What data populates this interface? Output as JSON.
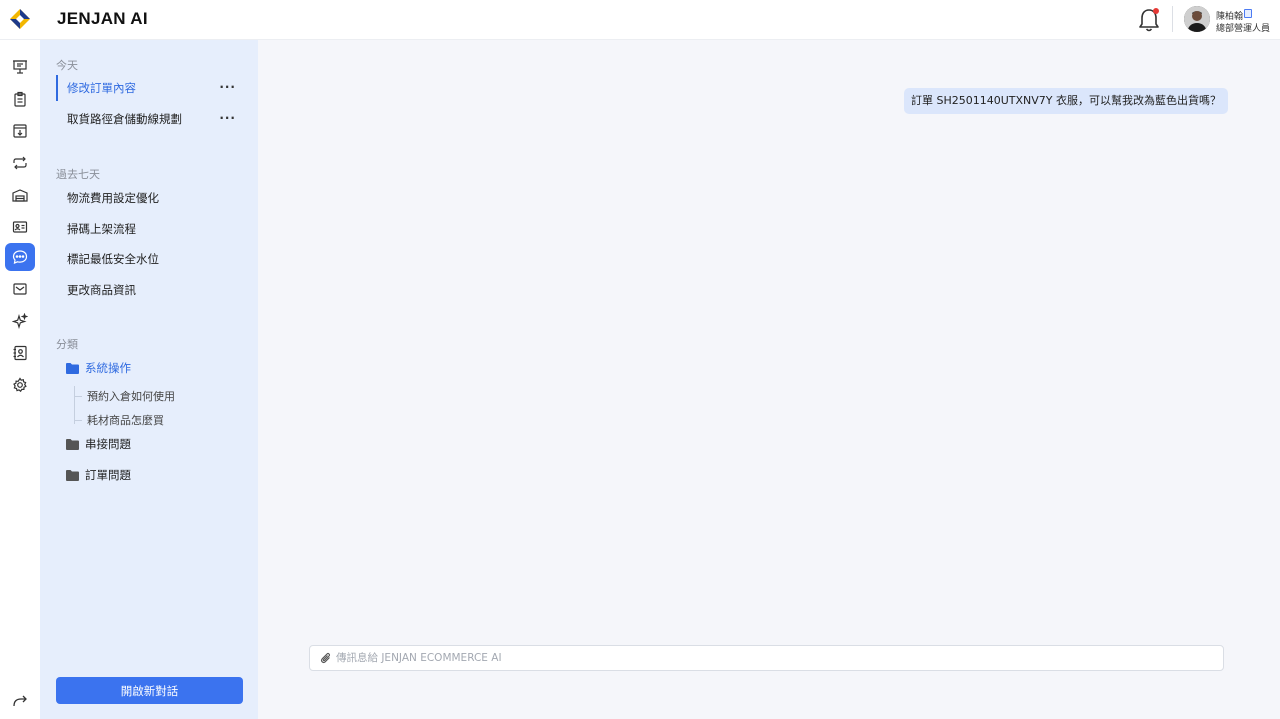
{
  "app": {
    "title": "JENJAN AI"
  },
  "header": {
    "user_name": "陳柏翰",
    "user_role": "總部營運人員"
  },
  "rail": {
    "icons": [
      "presentation-board-icon",
      "clipboard-icon",
      "inbox-download-icon",
      "repeat-arrows-icon",
      "warehouse-icon",
      "id-card-icon",
      "chat-bubble-icon",
      "mail-tray-icon",
      "sparkles-icon",
      "contacts-book-icon",
      "gear-icon"
    ],
    "active": "chat-bubble-icon",
    "accent": "#3b73ef"
  },
  "sidebar": {
    "today_label": "今天",
    "today": [
      {
        "label": "修改訂單內容",
        "active": true
      },
      {
        "label": "取貨路徑倉儲動線規劃",
        "active": false
      }
    ],
    "past_week_label": "過去七天",
    "past_week": [
      {
        "label": "物流費用設定優化"
      },
      {
        "label": "掃碼上架流程"
      },
      {
        "label": "標記最低安全水位"
      },
      {
        "label": "更改商品資訊"
      }
    ],
    "categories_label": "分類",
    "folders": [
      {
        "label": "系統操作",
        "open": true,
        "items": [
          "預約入倉如何使用",
          "耗材商品怎麼買"
        ]
      },
      {
        "label": "串接問題",
        "open": false
      },
      {
        "label": "訂單問題",
        "open": false
      }
    ],
    "new_chat_label": "開啟新對話"
  },
  "chat": {
    "messages": [
      {
        "role": "user",
        "text": "訂單 SH2501140UTXNV7Y 衣服，可以幫我改為藍色出貨嗎？"
      }
    ],
    "composer_placeholder": "傳訊息給 JENJAN ECOMMERCE AI",
    "composer_value": ""
  }
}
